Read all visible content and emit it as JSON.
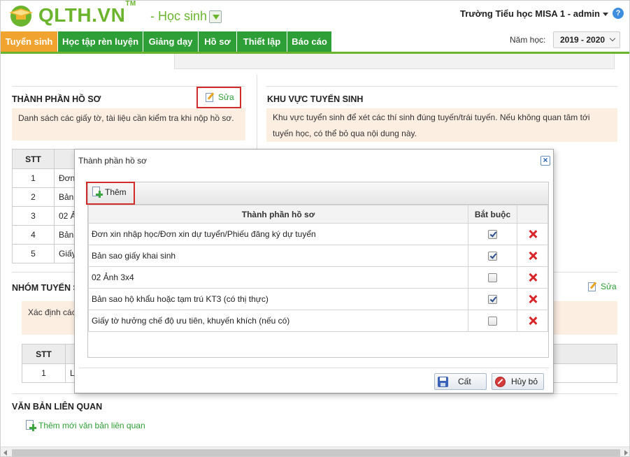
{
  "header": {
    "logo_text": "QLTH.VN",
    "logo_tm": "TM",
    "role": "- Học sinh",
    "user": "Trường Tiểu học MISA 1 - admin",
    "help": "?"
  },
  "nav": {
    "items": [
      "Tuyển sinh",
      "Học tập rèn luyện",
      "Giảng dạy",
      "Hồ sơ",
      "Thiết lập",
      "Báo cáo"
    ],
    "year_label": "Năm học:",
    "year_value": "2019 - 2020"
  },
  "profile_section": {
    "title": "THÀNH PHẦN HỒ SƠ",
    "edit": "Sửa",
    "notice": "Danh sách các giấy tờ, tài liệu cần kiểm tra khi nộp hồ sơ.",
    "col_stt": "STT",
    "rows": [
      {
        "stt": "1",
        "name": "Đơn"
      },
      {
        "stt": "2",
        "name": "Bản"
      },
      {
        "stt": "3",
        "name": "02 Ả"
      },
      {
        "stt": "4",
        "name": "Bản"
      },
      {
        "stt": "5",
        "name": "Giấy"
      }
    ]
  },
  "area_section": {
    "title": "KHU VỰC TUYỂN SINH",
    "notice": "Khu vực tuyển sinh để xét các thí sinh đúng tuyến/trái tuyến. Nếu không quan tâm tới tuyến học, có thể bỏ qua nội dung này."
  },
  "group_section": {
    "title": "NHÓM TUYỂN S",
    "edit": "Sửa",
    "notice": "Xác định các",
    "col_stt": "STT",
    "rows": [
      {
        "stt": "1",
        "name": "Lo"
      }
    ]
  },
  "related_section": {
    "title": "VĂN BẢN LIÊN QUAN",
    "add": "Thêm mới văn bản liên quan"
  },
  "dialog": {
    "title": "Thành phần hồ sơ",
    "close": "×",
    "add": "Thêm",
    "col_name": "Thành phần hồ sơ",
    "col_required": "Bắt buộc",
    "rows": [
      {
        "name": "Đơn xin nhập học/Đơn xin dự tuyển/Phiếu đăng ký dự tuyển",
        "required": true
      },
      {
        "name": "Bản sao giấy khai sinh",
        "required": true
      },
      {
        "name": "02 Ảnh 3x4",
        "required": false
      },
      {
        "name": "Bản sao hộ khẩu hoặc tạm trú KT3 (có thị thực)",
        "required": true
      },
      {
        "name": "Giấy tờ hưởng chế độ ưu tiên, khuyến khích (nếu có)",
        "required": false
      }
    ],
    "save": "Cất",
    "cancel": "Hủy bỏ"
  },
  "colors": {
    "brand_green": "#6bb52e",
    "nav_green": "#2e9e36",
    "nav_active": "#f0a32e",
    "notice_bg": "#fdeee2",
    "highlight_red": "#d12b2b"
  }
}
